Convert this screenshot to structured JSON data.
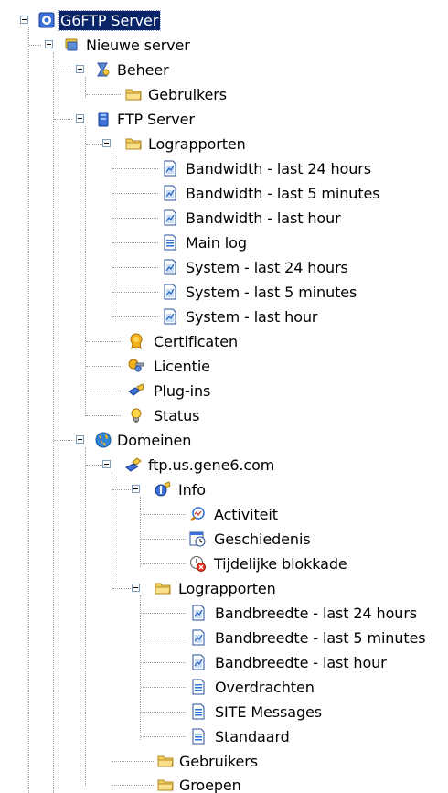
{
  "tree": {
    "root": {
      "label": "G6FTP Server",
      "icon": "server-admin-icon",
      "expanded": true,
      "selected": true
    },
    "server": {
      "label": "Nieuwe server",
      "icon": "server-icon",
      "expanded": true
    },
    "beheer": {
      "label": "Beheer",
      "icon": "admin-icon",
      "expanded": true
    },
    "beheer_gebruikers": {
      "label": "Gebruikers",
      "icon": "folder-icon"
    },
    "ftp_server": {
      "label": "FTP Server",
      "icon": "ftp-server-icon",
      "expanded": true
    },
    "lograpporten": {
      "label": "Lograpporten",
      "icon": "folder-icon",
      "expanded": true
    },
    "logs": [
      {
        "label": "Bandwidth - last 24 hours",
        "icon": "chart-document-icon"
      },
      {
        "label": "Bandwidth - last 5 minutes",
        "icon": "chart-document-icon"
      },
      {
        "label": "Bandwidth - last hour",
        "icon": "chart-document-icon"
      },
      {
        "label": "Main log",
        "icon": "text-document-icon"
      },
      {
        "label": "System - last 24 hours",
        "icon": "chart-document-icon"
      },
      {
        "label": "System - last 5 minutes",
        "icon": "chart-document-icon"
      },
      {
        "label": "System - last hour",
        "icon": "chart-document-icon"
      }
    ],
    "certificaten": {
      "label": "Certificaten",
      "icon": "certificate-icon"
    },
    "licentie": {
      "label": "Licentie",
      "icon": "license-key-icon"
    },
    "plugins": {
      "label": "Plug-ins",
      "icon": "plugin-icon"
    },
    "status": {
      "label": "Status",
      "icon": "lightbulb-icon"
    },
    "domeinen": {
      "label": "Domeinen",
      "icon": "globe-icon",
      "expanded": true
    },
    "domain": {
      "label": "ftp.us.gene6.com",
      "icon": "domain-icon",
      "expanded": true
    },
    "info": {
      "label": "Info",
      "icon": "info-icon",
      "expanded": true
    },
    "info_items": [
      {
        "label": "Activiteit",
        "icon": "activity-icon"
      },
      {
        "label": "Geschiedenis",
        "icon": "history-icon"
      },
      {
        "label": "Tijdelijke blokkade",
        "icon": "temporary-block-icon"
      }
    ],
    "domain_lograpporten": {
      "label": "Lograpporten",
      "icon": "folder-icon",
      "expanded": true
    },
    "domain_logs": [
      {
        "label": "Bandbreedte - last 24 hours",
        "icon": "chart-document-icon"
      },
      {
        "label": "Bandbreedte - last 5 minutes",
        "icon": "chart-document-icon"
      },
      {
        "label": "Bandbreedte - last hour",
        "icon": "chart-document-icon"
      },
      {
        "label": "Overdrachten",
        "icon": "text-document-icon"
      },
      {
        "label": "SITE Messages",
        "icon": "text-document-icon"
      },
      {
        "label": "Standaard",
        "icon": "text-document-icon"
      }
    ],
    "domain_gebruikers": {
      "label": "Gebruikers",
      "icon": "folder-icon"
    },
    "groepen": {
      "label": "Groepen",
      "icon": "folder-icon"
    }
  }
}
